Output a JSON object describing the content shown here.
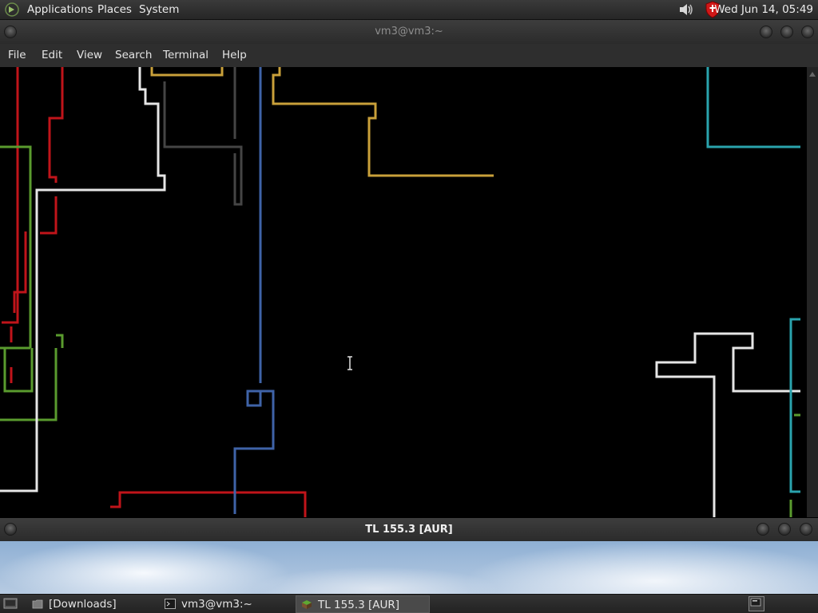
{
  "top_panel": {
    "menus": [
      "Applications",
      "Places",
      "System"
    ],
    "clock": "Wed Jun 14, 05:49",
    "icons": [
      "distro-logo-icon",
      "speaker-icon",
      "security-shield-icon"
    ]
  },
  "terminal_window": {
    "title": "vm3@vm3:~",
    "menu": [
      "File",
      "Edit",
      "View",
      "Search",
      "Terminal",
      "Help"
    ],
    "pipe_colors": {
      "red": "#c0141a",
      "green": "#5a9b2e",
      "white": "#e6e6e6",
      "yellow": "#c9a03a",
      "gray": "#454545",
      "blue": "#3f63a8",
      "cyan": "#2aa3ad"
    }
  },
  "second_window": {
    "title": "TL 155.3 [AUR]"
  },
  "taskbar": {
    "items": [
      {
        "label": "[Downloads]",
        "icon": "file-manager-icon"
      },
      {
        "label": "vm3@vm3:~",
        "icon": "terminal-icon"
      },
      {
        "label": "TL 155.3 [AUR]",
        "icon": "minecraft-block-icon",
        "active": true
      }
    ]
  }
}
